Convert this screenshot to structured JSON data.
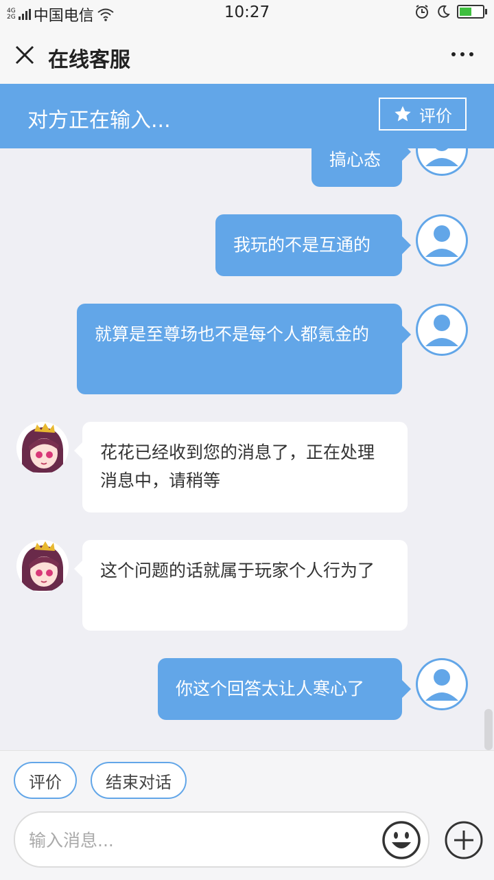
{
  "status_bar": {
    "network": "4G",
    "network2": "2G",
    "carrier": "中国电信",
    "time": "10:27",
    "battery_level": 0.6,
    "battery_color": "#3fbf3f"
  },
  "titlebar": {
    "close_icon": "close-icon",
    "title": "在线客服",
    "more_icon": "more-icon"
  },
  "banner": {
    "typing_text": "对方正在输入...",
    "rate_label": "评价",
    "rate_icon": "star-icon",
    "color": "#62a6e8"
  },
  "messages": [
    {
      "from": "user",
      "text": "搞心态"
    },
    {
      "from": "user",
      "text": "我玩的不是互通的"
    },
    {
      "from": "user",
      "text": "就算是至尊场也不是每个人都氪金的"
    },
    {
      "from": "agent",
      "text": "花花已经收到您的消息了，正在处理消息中，请稍等"
    },
    {
      "from": "agent",
      "text": "这个问题的话就属于玩家个人行为了"
    },
    {
      "from": "user",
      "text": "你这个回答太让人寒心了"
    }
  ],
  "bottom": {
    "chips": [
      "评价",
      "结束对话"
    ],
    "input_placeholder": "输入消息...",
    "emoji_icon": "emoji-icon",
    "plus_icon": "plus-icon"
  }
}
